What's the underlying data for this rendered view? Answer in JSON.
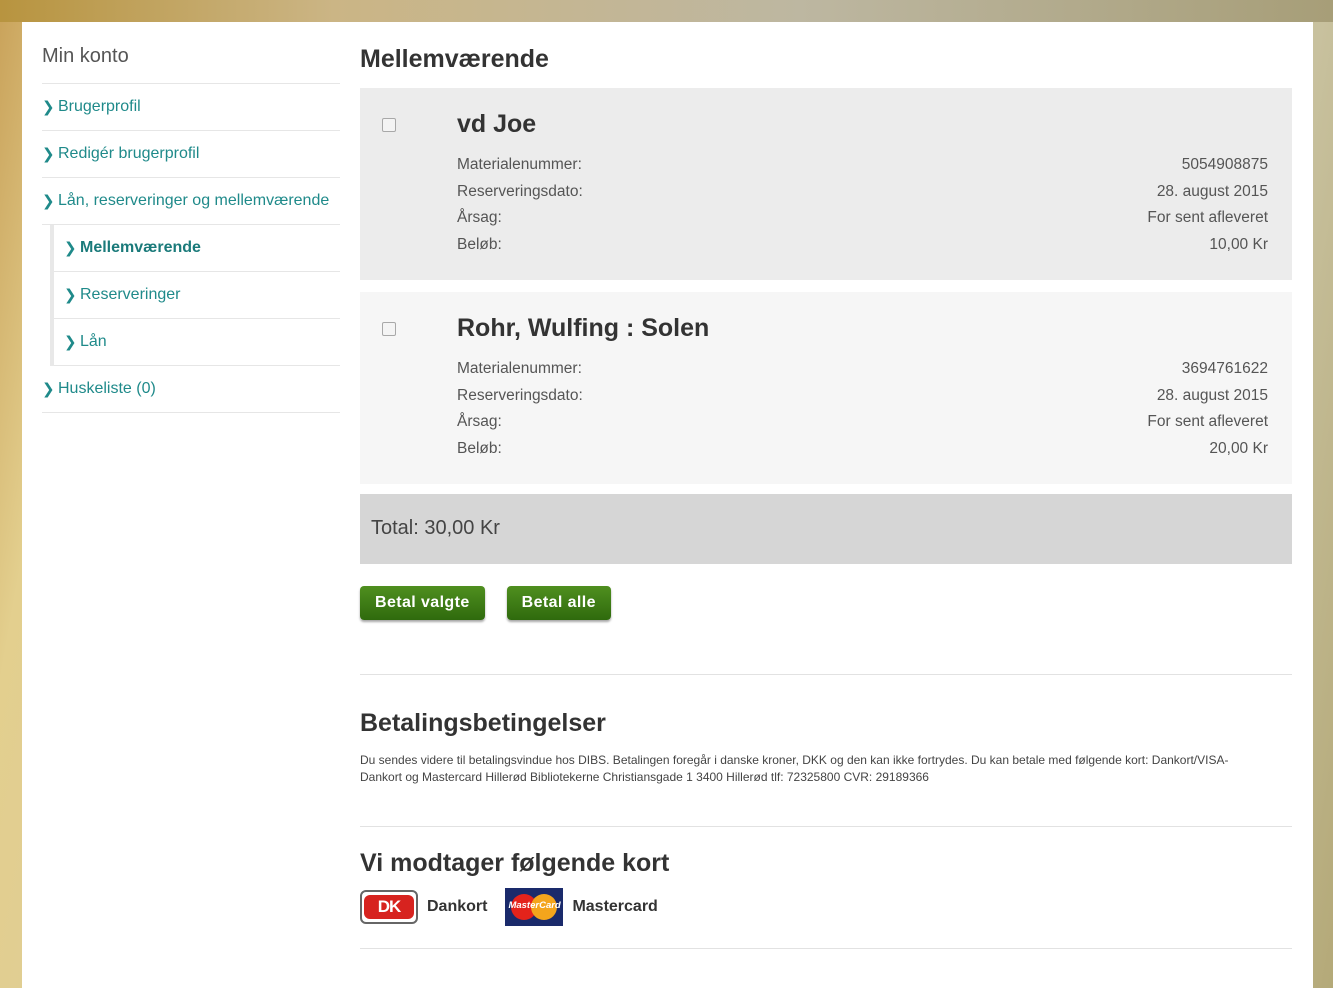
{
  "sidebar": {
    "title": "Min konto",
    "items": [
      {
        "label": "Brugerprofil"
      },
      {
        "label": "Redigér brugerprofil"
      },
      {
        "label": "Lån, reserveringer og mellemværende"
      }
    ],
    "sub_items": [
      {
        "label": "Mellemværende"
      },
      {
        "label": "Reserveringer"
      },
      {
        "label": "Lån"
      }
    ],
    "watchlist": "Huskeliste (0)"
  },
  "main": {
    "title": "Mellemværende",
    "debts": [
      {
        "name": "vd Joe",
        "material_label": "Materialenummer:",
        "material": "5054908875",
        "date_label": "Reserveringsdato:",
        "date": "28. august 2015",
        "reason_label": "Årsag:",
        "reason": "For sent afleveret",
        "amount_label": "Beløb:",
        "amount": "10,00 Kr"
      },
      {
        "name": "Rohr, Wulfing : Solen",
        "material_label": "Materialenummer:",
        "material": "3694761622",
        "date_label": "Reserveringsdato:",
        "date": "28. august 2015",
        "reason_label": "Årsag:",
        "reason": "For sent afleveret",
        "amount_label": "Beløb:",
        "amount": "20,00 Kr"
      }
    ],
    "total": "Total: 30,00 Kr",
    "pay_selected": "Betal valgte",
    "pay_all": "Betal alle",
    "terms_title": "Betalingsbetingelser",
    "terms_text": "Du sendes videre til betalingsvindue hos DIBS. Betalingen foregår i danske kroner, DKK og den kan ikke fortrydes. Du kan betale med følgende kort: Dankort/VISA-Dankort og Mastercard Hillerød Bibliotekerne Christiansgade 1 3400 Hillerød tlf: 72325800 CVR: 29189366",
    "cards_title": "Vi modtager følgende kort",
    "cards": [
      {
        "label": "Dankort",
        "logo_text": "DK"
      },
      {
        "label": "Mastercard",
        "logo_text": "MasterCard"
      }
    ]
  },
  "colors": {
    "link": "#1f8a8a",
    "button": "#3b7a14",
    "total_bg": "#d6d6d6"
  }
}
